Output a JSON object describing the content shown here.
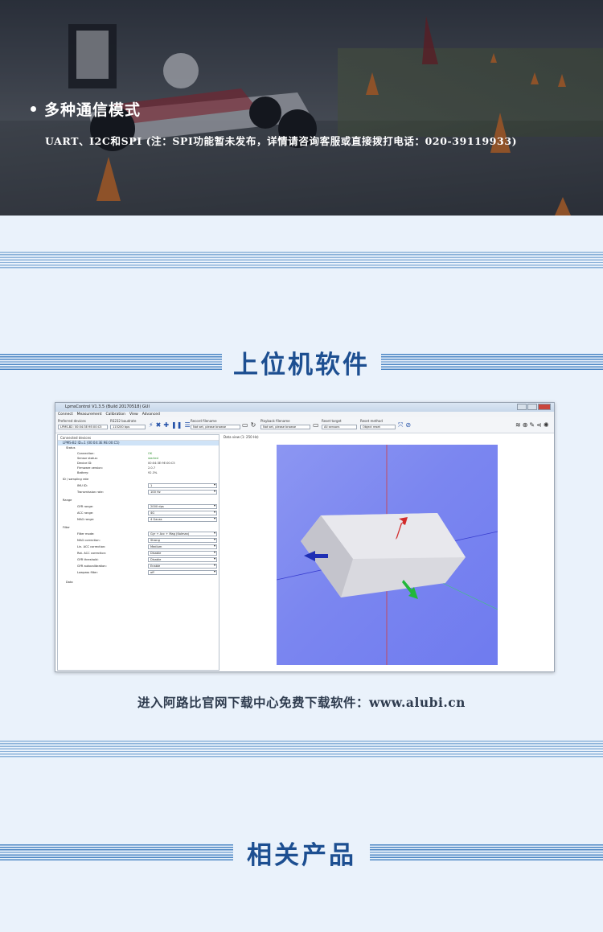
{
  "hero": {
    "bullet_title": "多种通信模式",
    "description": "UART、I2C和SPI (注：SPI功能暂未发布，详情请咨询客服或直接拨打电话：020-39119933)"
  },
  "section_software": {
    "title": "上位机软件"
  },
  "software_window": {
    "title": "LpmsControl V1.3.5 (Build 20170518) GUI",
    "menu": [
      "Connect",
      "Measurement",
      "Calibration",
      "View",
      "Advanced"
    ],
    "toolbar": {
      "preferred_devices_label": "Preferred devices",
      "preferred_devices_value": "LPMS-B2: 00:04:3E:9E:00:C5",
      "baudrate_label": "RS232 baudrate",
      "baudrate_value": "115200 bps",
      "record_label": "Record filename",
      "record_value": "Not set, please browse",
      "playback_label": "Playback filename",
      "playback_value": "Not set, please browse",
      "reset_target_label": "Reset target",
      "reset_target_value": "All sensors",
      "reset_method_label": "Reset method",
      "reset_method_value": "Object reset"
    },
    "connected_devices_label": "Connected devices",
    "device_row": "LPMS-B2 ID=1 (00:04:3E:9E:00:C5)",
    "tree": {
      "status_label": "Status",
      "status_rows": [
        {
          "k": "Connection:",
          "v": "OK"
        },
        {
          "k": "Sensor status:",
          "v": "started"
        },
        {
          "k": "Device ID:",
          "v": "00:04:3E:9E:00:C5"
        },
        {
          "k": "Firmware version:",
          "v": "2.0.7"
        },
        {
          "k": "Battery:",
          "v": "92.3%"
        }
      ],
      "id_label": "ID / sampling rate",
      "id_rows": [
        {
          "k": "IMU ID:",
          "v": "1"
        },
        {
          "k": "Transmission rate:",
          "v": "100 Hz"
        }
      ],
      "range_label": "Range",
      "range_rows": [
        {
          "k": "GYR range:",
          "v": "2000 dps"
        },
        {
          "k": "ACC range:",
          "v": "4G"
        },
        {
          "k": "MAG range:",
          "v": "4 Gauss"
        }
      ],
      "filter_label": "Filter",
      "filter_rows": [
        {
          "k": "Filter mode:",
          "v": "Gyr + Acc + Mag (Kalman)"
        },
        {
          "k": "MAG correction:",
          "v": "Strong"
        },
        {
          "k": "Lin. ACC correction:",
          "v": "Medium"
        },
        {
          "k": "Rot. ACC correction:",
          "v": "Disable"
        },
        {
          "k": "GYR threshold:",
          "v": "Disable"
        },
        {
          "k": "GYR autocalibration:",
          "v": "Enable"
        },
        {
          "k": "Lowpass filter:",
          "v": "off"
        }
      ],
      "data_label": "Data"
    },
    "view_caption": "Data view (1: 250 Hz)"
  },
  "download_caption": "进入阿路比官网下载中心免费下载软件：www.alubi.cn",
  "section_products": {
    "title": "相关产品"
  },
  "colors": {
    "accent_blue": "#1d4f91",
    "stripe_blue": "#4c86c4",
    "page_bg": "#eaf2fb",
    "viewport_blue": "#7b86f0"
  }
}
